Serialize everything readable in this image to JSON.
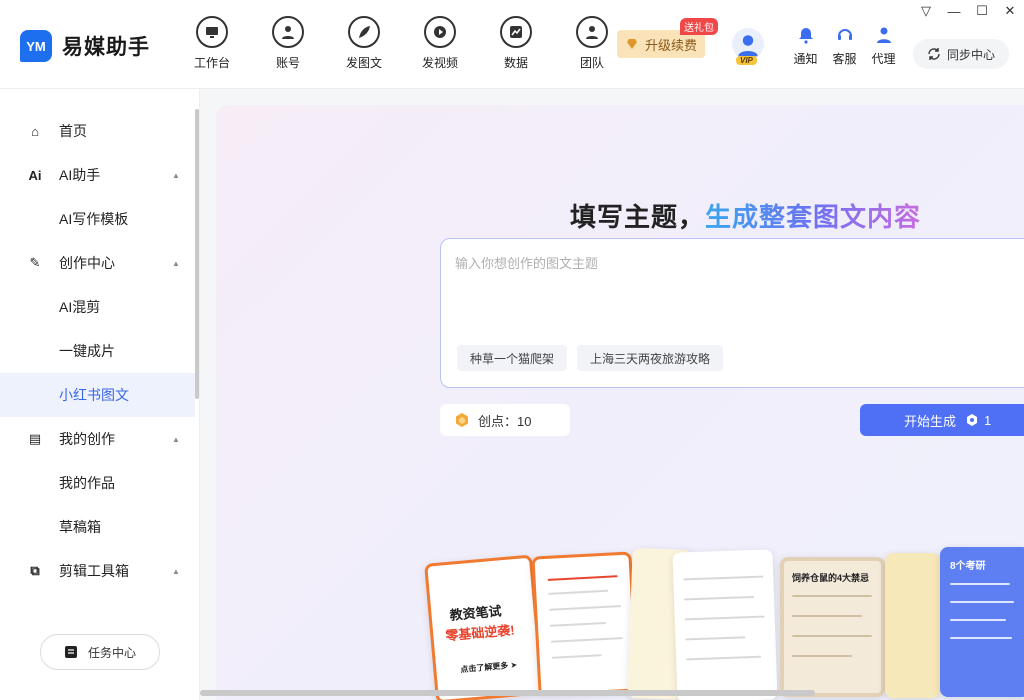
{
  "window": {
    "controls": [
      "▽",
      "—",
      "☐",
      "✕"
    ]
  },
  "app": {
    "logo_mark": "YM",
    "name": "易媒助手"
  },
  "nav": [
    {
      "label": "工作台",
      "icon": "monitor-icon"
    },
    {
      "label": "账号",
      "icon": "user-icon"
    },
    {
      "label": "发图文",
      "icon": "feather-icon"
    },
    {
      "label": "发视频",
      "icon": "play-icon"
    },
    {
      "label": "数据",
      "icon": "chart-icon"
    },
    {
      "label": "团队",
      "icon": "team-icon"
    }
  ],
  "upgrade": {
    "label": "升级续费",
    "badge": "送礼包"
  },
  "vip": {
    "tag": "VIP"
  },
  "tools": [
    {
      "label": "通知",
      "icon": "bell-icon"
    },
    {
      "label": "客服",
      "icon": "headset-icon"
    },
    {
      "label": "代理",
      "icon": "agent-icon"
    }
  ],
  "sync": {
    "label": "同步中心"
  },
  "sidebar": {
    "items": [
      {
        "label": "首页",
        "icon": "home-icon",
        "glyph": "⌂"
      },
      {
        "label": "AI助手",
        "icon": "ai-icon",
        "glyph": "Ai",
        "caret": "▲"
      },
      {
        "label": "AI写作模板"
      },
      {
        "label": "创作中心",
        "icon": "pencil-icon",
        "glyph": "✎",
        "caret": "▲"
      },
      {
        "label": "AI混剪"
      },
      {
        "label": "一键成片"
      },
      {
        "label": "小红书图文",
        "active": true
      },
      {
        "label": "我的创作",
        "icon": "document-icon",
        "glyph": "▤",
        "caret": "▲"
      },
      {
        "label": "我的作品"
      },
      {
        "label": "草稿箱"
      },
      {
        "label": "剪辑工具箱",
        "icon": "crop-icon",
        "glyph": "⧉",
        "caret": "▲"
      }
    ],
    "task_center": "任务中心"
  },
  "main": {
    "title_plain": "填写主题，",
    "title_highlight": "生成整套图文内容",
    "input_placeholder": "输入你想创作的图文主题",
    "chips": [
      "种草一个猫爬架",
      "上海三天两夜旅游攻略"
    ],
    "points_label": "创点：10",
    "generate_label": "开始生成",
    "generate_cost": "1"
  },
  "cards": {
    "card1_title_a": "教资笔试",
    "card1_title_b": "零基础逆袭!",
    "card1_footer": "点击了解更多 ➤",
    "card4_title": "饲养仓鼠的4大禁忌",
    "card6_title": "8个考研"
  },
  "colors": {
    "accent": "#4f6ff4",
    "active_bg": "#eef2fd",
    "upgrade_bg": "#fbe3b9",
    "badge_red": "#f04848"
  }
}
